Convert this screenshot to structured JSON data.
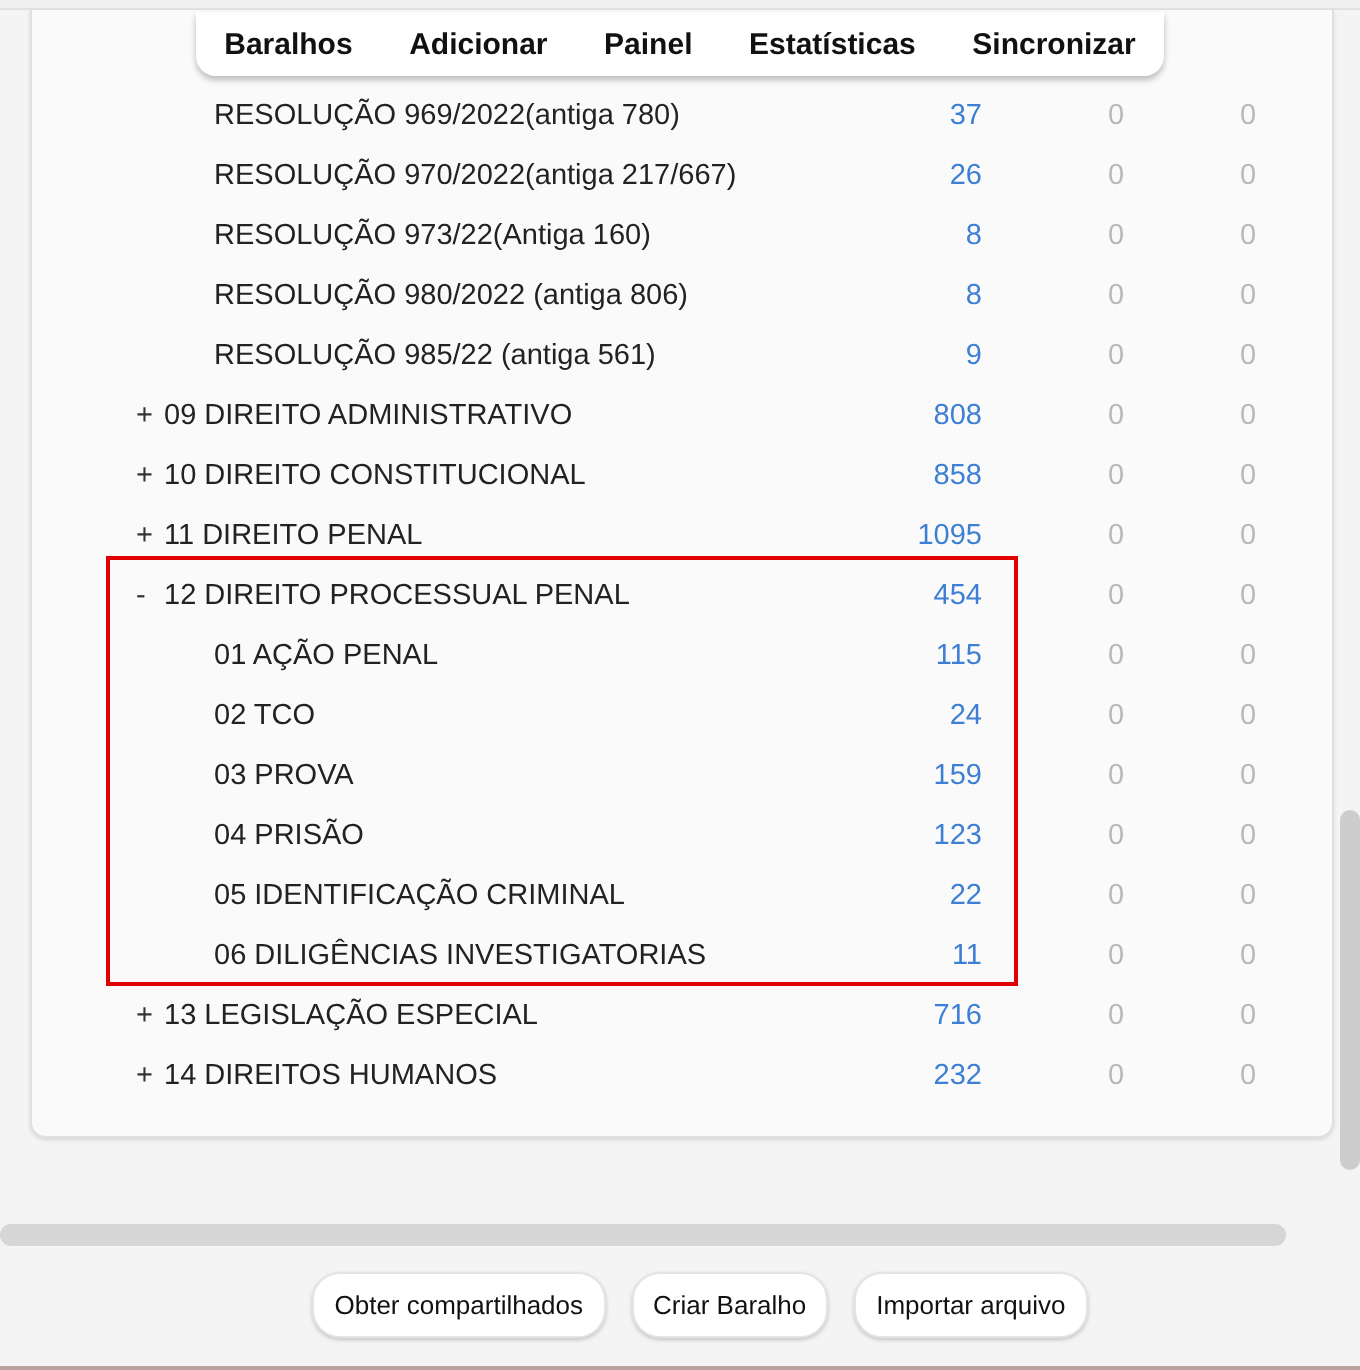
{
  "toolbar": {
    "items": [
      {
        "label": "Baralhos"
      },
      {
        "label": "Adicionar"
      },
      {
        "label": "Painel"
      },
      {
        "label": "Estatísticas"
      },
      {
        "label": "Sincronizar"
      }
    ]
  },
  "decks": [
    {
      "children": [
        {
          "name": "RESOLUÇÃO 969/2022(antiga 780)",
          "new": "37",
          "learn": "0",
          "due": "0"
        },
        {
          "name": "RESOLUÇÃO 970/2022(antiga 217/667)",
          "new": "26",
          "learn": "0",
          "due": "0"
        },
        {
          "name": "RESOLUÇÃO 973/22(Antiga 160)",
          "new": "8",
          "learn": "0",
          "due": "0"
        },
        {
          "name": "RESOLUÇÃO 980/2022 (antiga 806)",
          "new": "8",
          "learn": "0",
          "due": "0"
        },
        {
          "name": "RESOLUÇÃO 985/22 (antiga 561)",
          "new": "9",
          "learn": "0",
          "due": "0"
        }
      ]
    },
    {
      "toggle": "+",
      "name": "09 DIREITO ADMINISTRATIVO",
      "new": "808",
      "learn": "0",
      "due": "0",
      "highlighted": false
    },
    {
      "toggle": "+",
      "name": "10 DIREITO CONSTITUCIONAL",
      "new": "858",
      "learn": "0",
      "due": "0",
      "highlighted": false
    },
    {
      "toggle": "+",
      "name": "11 DIREITO PENAL",
      "new": "1095",
      "learn": "0",
      "due": "0",
      "highlighted": false
    },
    {
      "toggle": "-",
      "name": "12 DIREITO PROCESSUAL PENAL",
      "new": "454",
      "learn": "0",
      "due": "0",
      "highlighted": true,
      "children": [
        {
          "name": "01 AÇÃO PENAL",
          "new": "115",
          "learn": "0",
          "due": "0"
        },
        {
          "name": "02 TCO",
          "new": "24",
          "learn": "0",
          "due": "0"
        },
        {
          "name": "03 PROVA",
          "new": "159",
          "learn": "0",
          "due": "0"
        },
        {
          "name": "04 PRISÃO",
          "new": "123",
          "learn": "0",
          "due": "0"
        },
        {
          "name": "05 IDENTIFICAÇÃO CRIMINAL",
          "new": "22",
          "learn": "0",
          "due": "0"
        },
        {
          "name": "06 DILIGÊNCIAS INVESTIGATORIAS",
          "new": "11",
          "learn": "0",
          "due": "0"
        }
      ]
    },
    {
      "toggle": "+",
      "name": "13 LEGISLAÇÃO ESPECIAL",
      "new": "716",
      "learn": "0",
      "due": "0",
      "highlighted": false
    },
    {
      "toggle": "+",
      "name": "14 DIREITOS HUMANOS",
      "new": "232",
      "learn": "0",
      "due": "0",
      "highlighted": false
    }
  ],
  "buttons": [
    {
      "label": "Obter compartilhados"
    },
    {
      "label": "Criar Baralho"
    },
    {
      "label": "Importar arquivo"
    }
  ]
}
